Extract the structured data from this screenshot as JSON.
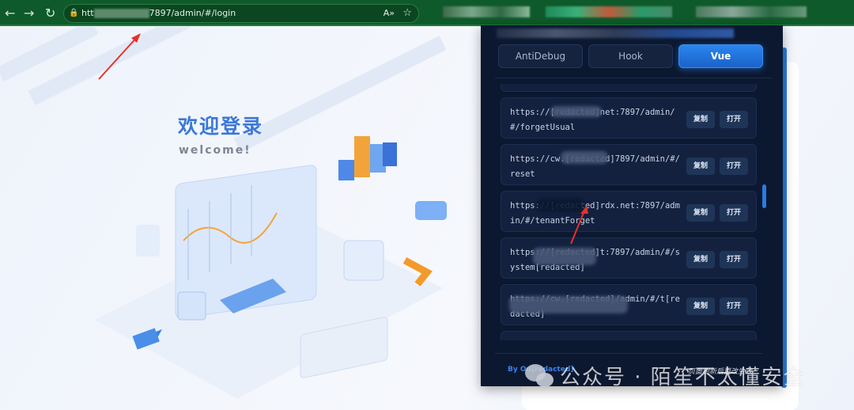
{
  "browser": {
    "url": "http://[redacted]7897/admin/#/login",
    "url_prefix": "htt",
    "url_suffix": "7897/admin/#/login",
    "back": "←",
    "forward": "→",
    "reload": "↻",
    "read_aloud": "A»",
    "favorite": "☆"
  },
  "login": {
    "title": "欢迎登录",
    "subtitle": "welcome!"
  },
  "popup": {
    "tabs": [
      {
        "label": "AntiDebug"
      },
      {
        "label": "Hook"
      },
      {
        "label": "Vue"
      }
    ],
    "routes": [
      {
        "url": "https://[redacted]net:7897/admin/#/forgetUsual",
        "copy": "复制",
        "open": "打开"
      },
      {
        "url": "https://cw.[redacted]7897/admin/#/reset",
        "copy": "复制",
        "open": "打开"
      },
      {
        "url": "https://[redacted]rdx.net:7897/admin/#/tenantForget",
        "copy": "复制",
        "open": "打开"
      },
      {
        "url": "https://[redacted]t:7897/admin/#/system[redacted]",
        "copy": "复制",
        "open": "打开"
      },
      {
        "url": "https://cw.[redacted]/admin/#/t[redacted]",
        "copy": "复制",
        "open": "打开"
      }
    ],
    "footer_by": "By Ou[redacted]",
    "footer_note": "页面刷新后更改生效"
  },
  "watermark": "公众号 · 陌笙不太懂安全",
  "colors": {
    "accent": "#2a86ee",
    "popup_bg": "#0c1830",
    "browser_bar": "#0f5a2a",
    "title": "#3b78d8"
  }
}
